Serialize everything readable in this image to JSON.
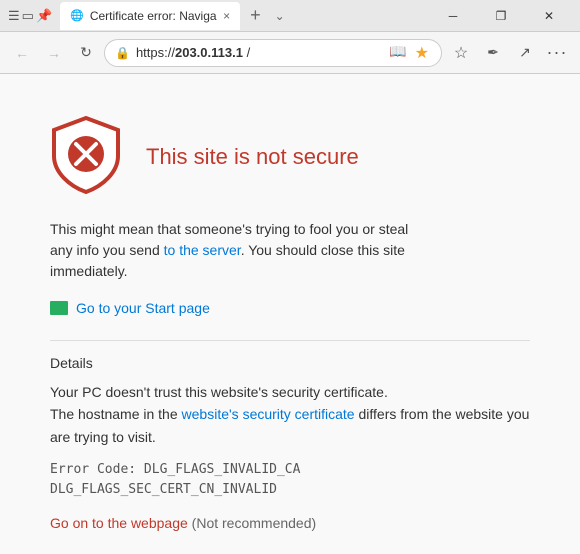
{
  "titlebar": {
    "tab_title": "Certificate error: Naviga",
    "tab_icon": "🌐",
    "close_tab_label": "×",
    "add_tab_label": "+",
    "tab_list_label": "❯",
    "minimize_label": "─",
    "restore_label": "❐",
    "close_window_label": "✕"
  },
  "addressbar": {
    "back_label": "←",
    "forward_label": "→",
    "refresh_label": "↻",
    "lock_icon": "🔒",
    "address_prefix": "https://",
    "address_host": "203.0.113.1",
    "address_suffix": " /",
    "reader_icon": "📖",
    "favorites_icon": "★",
    "fav_toolbar_icon": "☆",
    "notes_icon": "✏",
    "share_icon": "↗",
    "more_icon": "···"
  },
  "page": {
    "error_title": "This site is not secure",
    "description_line1": "This might mean that someone's trying to fool you",
    "description_line2": "or steal any info you send",
    "description_link": "to the server",
    "description_line3": ". You should",
    "description_line4": "close this site immediately.",
    "start_page_label": "Go to your Start page",
    "details_heading": "Details",
    "details_text1": "Your PC doesn't trust this website's security certificate.",
    "details_text2": "The hostname in the website's security certificate differs from the website you are trying to visit.",
    "error_code_line1": "Error Code:  DLG_FLAGS_INVALID_CA",
    "error_code_line2": "DLG_FLAGS_SEC_CERT_CN_INVALID",
    "go_on_label": "Go on to the webpage",
    "not_recommended_label": "(Not recommended)"
  }
}
